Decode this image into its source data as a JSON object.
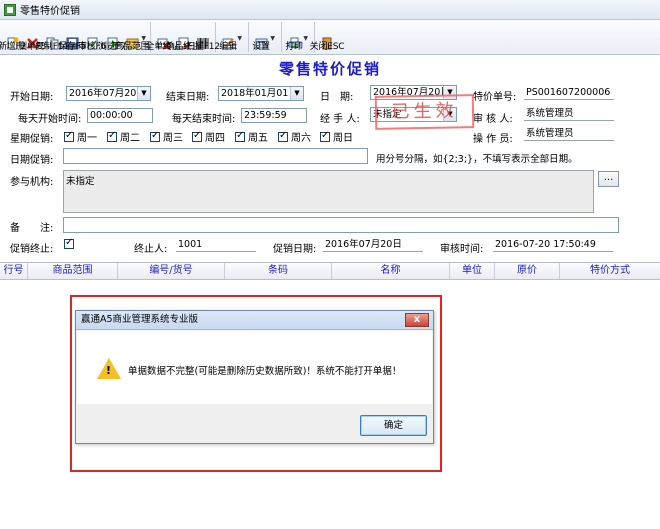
{
  "window": {
    "title": "零售特价促销"
  },
  "toolbar": {
    "items": [
      {
        "label": "新增F2",
        "icon": "new-doc-icon"
      },
      {
        "label": "删单F3",
        "icon": "delete-x-icon"
      },
      {
        "label": "复制F11",
        "icon": "copy-icon"
      },
      {
        "label": "保存F5",
        "icon": "save-icon"
      },
      {
        "label": "审核F6",
        "icon": "audit-icon"
      },
      {
        "label": "浏览F7",
        "icon": "browse-icon"
      },
      {
        "label": "商品范围",
        "icon": "product-range-icon"
      },
      {
        "label": "全单终止",
        "icon": "terminate-all-icon"
      },
      {
        "label": "单品终止",
        "icon": "terminate-item-icon"
      },
      {
        "label": "扫描F12",
        "icon": "barcode-icon"
      },
      {
        "label": "编辑",
        "icon": "edit-icon"
      },
      {
        "label": "设置",
        "icon": "settings-icon"
      },
      {
        "label": "打印",
        "icon": "print-icon"
      },
      {
        "label": "关闭ESC",
        "icon": "close-door-icon"
      }
    ]
  },
  "form": {
    "title": "零售特价促销",
    "start_date_label": "开始日期:",
    "start_date": "2016年07月20日",
    "end_date_label": "结束日期:",
    "end_date": "2018年01月01日",
    "date_label": "日　期:",
    "date": "2016年07月20日",
    "order_no_label": "特价单号:",
    "order_no": "PS001607200006",
    "daily_start_label": "每天开始时间:",
    "daily_start": "00:00:00",
    "daily_end_label": "每天结束时间:",
    "daily_end": "23:59:59",
    "handler_label": "经 手 人:",
    "handler": "未指定",
    "auditor_label": "审 核 人:",
    "auditor": "系统管理员",
    "operator_label": "操 作 员:",
    "operator": "系统管理员",
    "weekday_label": "星期促销:",
    "weekdays": [
      "周一",
      "周二",
      "周三",
      "周四",
      "周五",
      "周六",
      "周日"
    ],
    "date_promo_label": "日期促销:",
    "date_promo_hint": "用分号分隔，如{2;3;}，不填写表示全部日期。",
    "org_label": "参与机构:",
    "org_value": "未指定",
    "ellipsis": "...",
    "remark_label": "备　　注:",
    "terminated_label": "促销终止:",
    "terminator_label": "终止人:",
    "terminator": "1001",
    "promo_date_label": "促销日期:",
    "promo_date": "2016年07月20日",
    "audit_time_label": "审核时间:",
    "audit_time": "2016-07-20 17:50:49"
  },
  "stamp": {
    "text": "已生效"
  },
  "grid": {
    "columns": [
      "行号",
      "商品范围",
      "编号/货号",
      "条码",
      "名称",
      "单位",
      "原价",
      "特价方式"
    ]
  },
  "dialog": {
    "title": "赢通A5商业管理系统专业版",
    "close": "x",
    "message": "单据数据不完整(可能是删除历史数据所致)！系统不能打开单据！",
    "ok": "确定"
  },
  "colors": {
    "accent": "#1b1bd0",
    "highlight": "#e02424",
    "stamp": "#e24c4c"
  }
}
